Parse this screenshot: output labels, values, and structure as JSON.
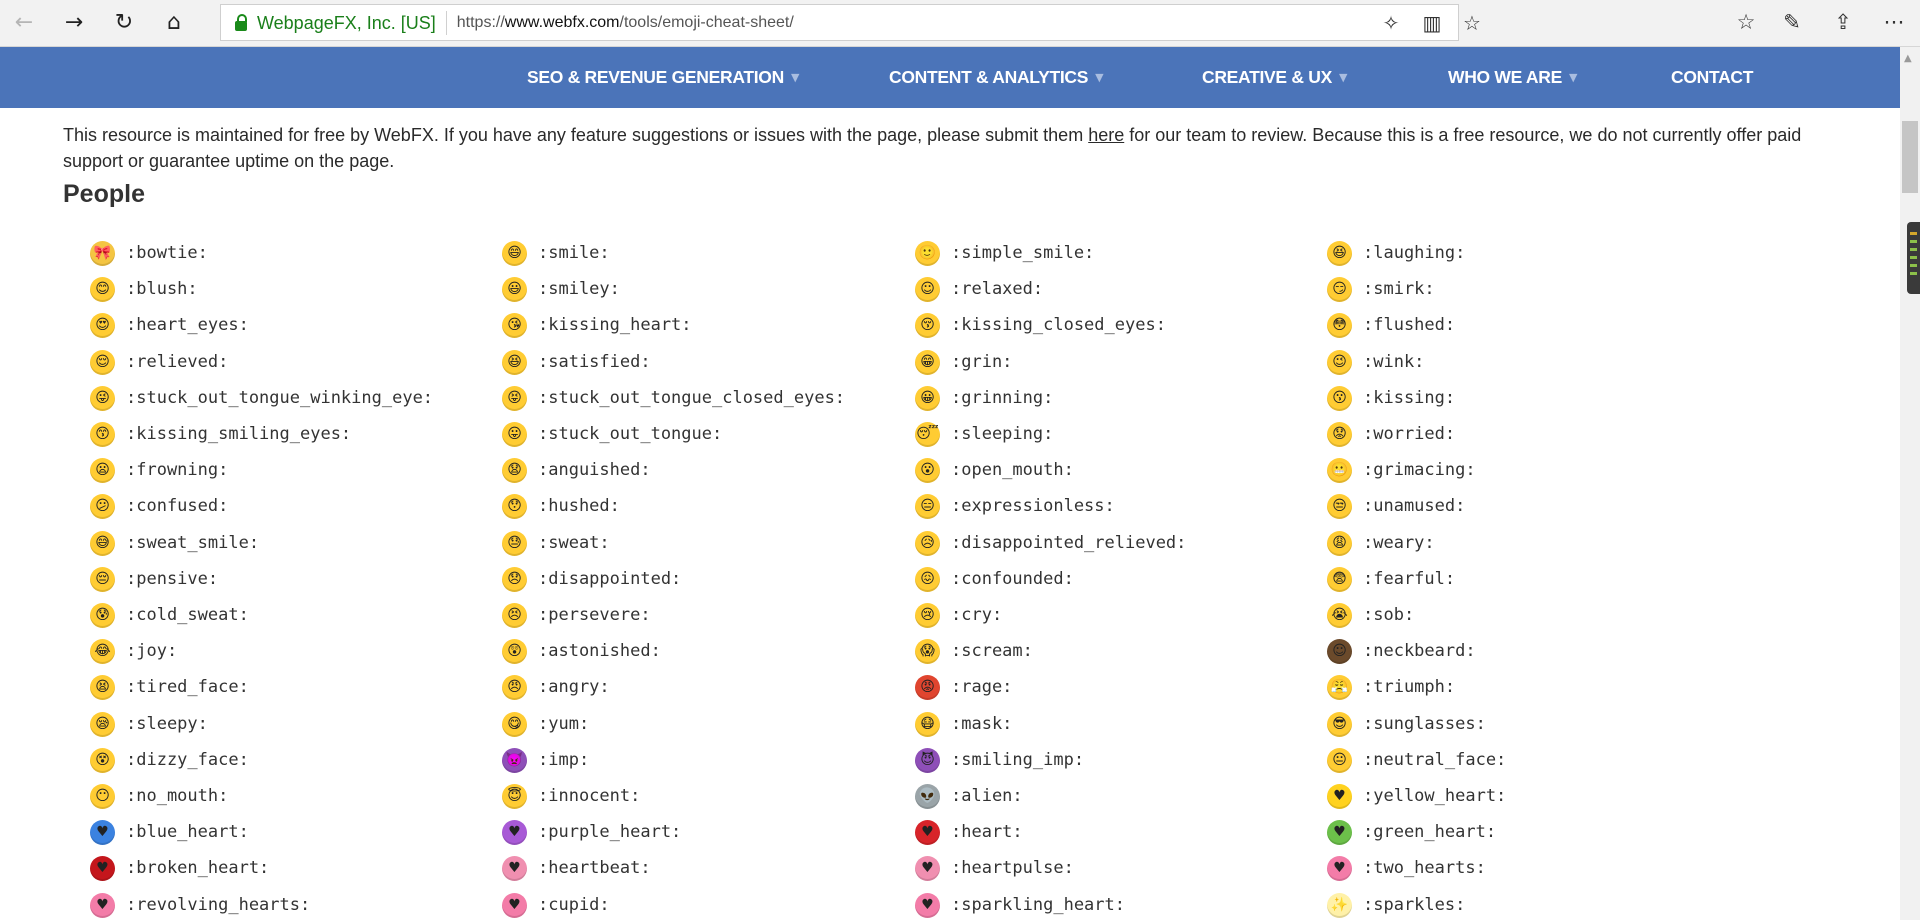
{
  "browser": {
    "site_identity": "WebpageFX, Inc. [US]",
    "url_prefix": "https://",
    "url_host": "www.webfx.com",
    "url_path": "/tools/emoji-cheat-sheet/",
    "icons": {
      "back": "arrow-left-icon",
      "forward": "arrow-right-icon",
      "refresh": "refresh-icon",
      "home": "home-icon",
      "extensions": "puzzle-icon",
      "reading_view": "book-icon",
      "favorite": "star-icon",
      "favorites_hub": "favorites-list-icon",
      "notes": "pen-icon",
      "share": "share-icon",
      "more": "more-icon"
    }
  },
  "nav": {
    "items": [
      {
        "label": "SEO & REVENUE GENERATION",
        "has_caret": true
      },
      {
        "label": "CONTENT & ANALYTICS",
        "has_caret": true
      },
      {
        "label": "CREATIVE & UX",
        "has_caret": true
      },
      {
        "label": "WHO WE ARE",
        "has_caret": true
      },
      {
        "label": "CONTACT",
        "has_caret": false
      }
    ],
    "background": "#4b74b9"
  },
  "intro": {
    "text_before": "This resource is maintained for free by WebFX. If you have any feature suggestions or issues with the page, please submit them ",
    "link": "here",
    "text_after": " for our team to review. Because this is a free resource, we do not currently offer paid support or guarantee uptime on the page."
  },
  "section_title": "People",
  "emojis": [
    [
      {
        "code": ":bowtie:",
        "color": "#f4c542",
        "glyph": "🎀"
      },
      {
        "code": ":smile:",
        "color": "#ffcc33",
        "glyph": "😄"
      },
      {
        "code": ":simple_smile:",
        "color": "#ffcc33",
        "glyph": "🙂"
      },
      {
        "code": ":laughing:",
        "color": "#ffcc33",
        "glyph": "😆"
      }
    ],
    [
      {
        "code": ":blush:",
        "color": "#ffcc33",
        "glyph": "😊"
      },
      {
        "code": ":smiley:",
        "color": "#ffcc33",
        "glyph": "😃"
      },
      {
        "code": ":relaxed:",
        "color": "#ffcc33",
        "glyph": "☺"
      },
      {
        "code": ":smirk:",
        "color": "#ffcc33",
        "glyph": "😏"
      }
    ],
    [
      {
        "code": ":heart_eyes:",
        "color": "#ffcc33",
        "glyph": "😍"
      },
      {
        "code": ":kissing_heart:",
        "color": "#ffcc33",
        "glyph": "😘"
      },
      {
        "code": ":kissing_closed_eyes:",
        "color": "#ffcc33",
        "glyph": "😚"
      },
      {
        "code": ":flushed:",
        "color": "#ffcc33",
        "glyph": "😳"
      }
    ],
    [
      {
        "code": ":relieved:",
        "color": "#ffcc33",
        "glyph": "😌"
      },
      {
        "code": ":satisfied:",
        "color": "#ffcc33",
        "glyph": "😆"
      },
      {
        "code": ":grin:",
        "color": "#ffcc33",
        "glyph": "😁"
      },
      {
        "code": ":wink:",
        "color": "#ffcc33",
        "glyph": "😉"
      }
    ],
    [
      {
        "code": ":stuck_out_tongue_winking_eye:",
        "color": "#ffcc33",
        "glyph": "😜"
      },
      {
        "code": ":stuck_out_tongue_closed_eyes:",
        "color": "#ffcc33",
        "glyph": "😝"
      },
      {
        "code": ":grinning:",
        "color": "#ffcc33",
        "glyph": "😀"
      },
      {
        "code": ":kissing:",
        "color": "#ffcc33",
        "glyph": "😗"
      }
    ],
    [
      {
        "code": ":kissing_smiling_eyes:",
        "color": "#ffcc33",
        "glyph": "😙"
      },
      {
        "code": ":stuck_out_tongue:",
        "color": "#ffcc33",
        "glyph": "😛"
      },
      {
        "code": ":sleeping:",
        "color": "#ffcc33",
        "glyph": "😴"
      },
      {
        "code": ":worried:",
        "color": "#ffcc33",
        "glyph": "😟"
      }
    ],
    [
      {
        "code": ":frowning:",
        "color": "#ffcc33",
        "glyph": "😦"
      },
      {
        "code": ":anguished:",
        "color": "#ffcc33",
        "glyph": "😧"
      },
      {
        "code": ":open_mouth:",
        "color": "#ffcc33",
        "glyph": "😮"
      },
      {
        "code": ":grimacing:",
        "color": "#ffcc33",
        "glyph": "😬"
      }
    ],
    [
      {
        "code": ":confused:",
        "color": "#ffcc33",
        "glyph": "😕"
      },
      {
        "code": ":hushed:",
        "color": "#ffcc33",
        "glyph": "😯"
      },
      {
        "code": ":expressionless:",
        "color": "#ffcc33",
        "glyph": "😑"
      },
      {
        "code": ":unamused:",
        "color": "#ffcc33",
        "glyph": "😒"
      }
    ],
    [
      {
        "code": ":sweat_smile:",
        "color": "#ffcc33",
        "glyph": "😅"
      },
      {
        "code": ":sweat:",
        "color": "#ffcc33",
        "glyph": "😓"
      },
      {
        "code": ":disappointed_relieved:",
        "color": "#ffcc33",
        "glyph": "😥"
      },
      {
        "code": ":weary:",
        "color": "#ffcc33",
        "glyph": "😩"
      }
    ],
    [
      {
        "code": ":pensive:",
        "color": "#ffcc33",
        "glyph": "😔"
      },
      {
        "code": ":disappointed:",
        "color": "#ffcc33",
        "glyph": "😞"
      },
      {
        "code": ":confounded:",
        "color": "#ffcc33",
        "glyph": "😖"
      },
      {
        "code": ":fearful:",
        "color": "#ffcc33",
        "glyph": "😨"
      }
    ],
    [
      {
        "code": ":cold_sweat:",
        "color": "#ffcc33",
        "glyph": "😰"
      },
      {
        "code": ":persevere:",
        "color": "#ffcc33",
        "glyph": "😣"
      },
      {
        "code": ":cry:",
        "color": "#ffcc33",
        "glyph": "😢"
      },
      {
        "code": ":sob:",
        "color": "#ffcc33",
        "glyph": "😭"
      }
    ],
    [
      {
        "code": ":joy:",
        "color": "#ffcc33",
        "glyph": "😂"
      },
      {
        "code": ":astonished:",
        "color": "#ffcc33",
        "glyph": "😲"
      },
      {
        "code": ":scream:",
        "color": "#ffcc33",
        "glyph": "😱"
      },
      {
        "code": ":neckbeard:",
        "color": "#6b4a2b",
        "glyph": "☺"
      }
    ],
    [
      {
        "code": ":tired_face:",
        "color": "#ffcc33",
        "glyph": "😫"
      },
      {
        "code": ":angry:",
        "color": "#ffcc33",
        "glyph": "😠"
      },
      {
        "code": ":rage:",
        "color": "#e0452f",
        "glyph": "😡"
      },
      {
        "code": ":triumph:",
        "color": "#ffcc33",
        "glyph": "😤"
      }
    ],
    [
      {
        "code": ":sleepy:",
        "color": "#ffcc33",
        "glyph": "😪"
      },
      {
        "code": ":yum:",
        "color": "#ffcc33",
        "glyph": "😋"
      },
      {
        "code": ":mask:",
        "color": "#ffcc33",
        "glyph": "😷"
      },
      {
        "code": ":sunglasses:",
        "color": "#ffcc33",
        "glyph": "😎"
      }
    ],
    [
      {
        "code": ":dizzy_face:",
        "color": "#ffcc33",
        "glyph": "😵"
      },
      {
        "code": ":imp:",
        "color": "#8e4fb8",
        "glyph": "👿"
      },
      {
        "code": ":smiling_imp:",
        "color": "#8e4fb8",
        "glyph": "😈"
      },
      {
        "code": ":neutral_face:",
        "color": "#ffcc33",
        "glyph": "😐"
      }
    ],
    [
      {
        "code": ":no_mouth:",
        "color": "#ffcc33",
        "glyph": "😶"
      },
      {
        "code": ":innocent:",
        "color": "#ffcc33",
        "glyph": "😇"
      },
      {
        "code": ":alien:",
        "color": "#9aa4a8",
        "glyph": "👽"
      },
      {
        "code": ":yellow_heart:",
        "color": "#ffd21f",
        "glyph": "♥"
      }
    ],
    [
      {
        "code": ":blue_heart:",
        "color": "#3b82e0",
        "glyph": "♥"
      },
      {
        "code": ":purple_heart:",
        "color": "#a85ad6",
        "glyph": "♥"
      },
      {
        "code": ":heart:",
        "color": "#d8242a",
        "glyph": "♥"
      },
      {
        "code": ":green_heart:",
        "color": "#6cc04a",
        "glyph": "♥"
      }
    ],
    [
      {
        "code": ":broken_heart:",
        "color": "#c4161c",
        "glyph": "♥"
      },
      {
        "code": ":heartbeat:",
        "color": "#f08fb0",
        "glyph": "♥"
      },
      {
        "code": ":heartpulse:",
        "color": "#f08fb0",
        "glyph": "♥"
      },
      {
        "code": ":two_hearts:",
        "color": "#f37ca8",
        "glyph": "♥"
      }
    ],
    [
      {
        "code": ":revolving_hearts:",
        "color": "#f37ca8",
        "glyph": "♥"
      },
      {
        "code": ":cupid:",
        "color": "#f37ca8",
        "glyph": "♥"
      },
      {
        "code": ":sparkling_heart:",
        "color": "#f37ca8",
        "glyph": "♥"
      },
      {
        "code": ":sparkles:",
        "color": "#fff1a8",
        "glyph": "✨"
      }
    ]
  ]
}
